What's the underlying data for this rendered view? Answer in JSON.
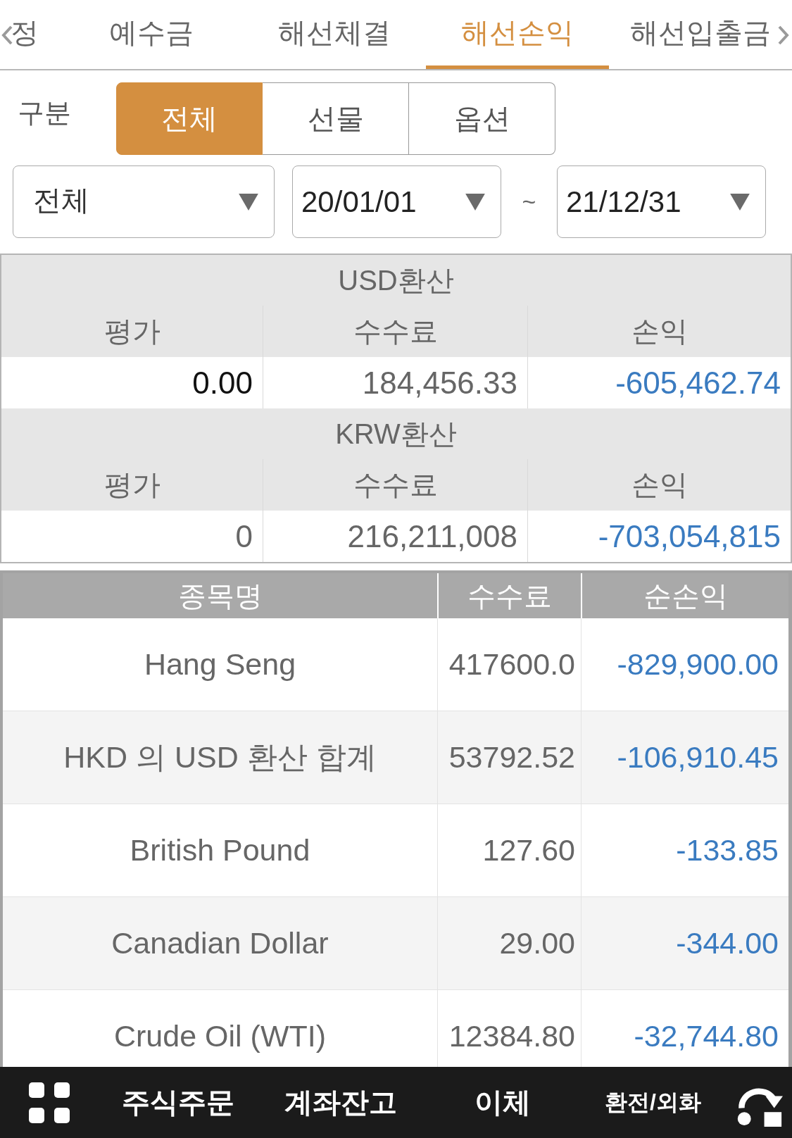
{
  "tabs": [
    {
      "label": "정",
      "selected": false
    },
    {
      "label": "예수금",
      "selected": false
    },
    {
      "label": "해선체결",
      "selected": false
    },
    {
      "label": "해선손익",
      "selected": true
    },
    {
      "label": "해선입출금",
      "selected": false
    }
  ],
  "filters": {
    "category_label": "구분",
    "segments": [
      {
        "label": "전체",
        "selected": true
      },
      {
        "label": "선물",
        "selected": false
      },
      {
        "label": "옵션",
        "selected": false
      }
    ],
    "type_dropdown": {
      "value": "전체"
    },
    "date_from": {
      "value": "20/01/01"
    },
    "date_separator": "~",
    "date_to": {
      "value": "21/12/31"
    }
  },
  "summary": [
    {
      "title": "USD환산",
      "columns": [
        "평가",
        "수수료",
        "손익"
      ],
      "values": [
        {
          "text": "0.00",
          "kind": "strong"
        },
        {
          "text": "184,456.33",
          "kind": "plain"
        },
        {
          "text": "-605,462.74",
          "kind": "loss"
        }
      ]
    },
    {
      "title": "KRW환산",
      "columns": [
        "평가",
        "수수료",
        "손익"
      ],
      "values": [
        {
          "text": "0",
          "kind": "plain"
        },
        {
          "text": "216,211,008",
          "kind": "plain"
        },
        {
          "text": "-703,054,815",
          "kind": "loss"
        }
      ]
    }
  ],
  "positions": {
    "columns": [
      "종목명",
      "수수료",
      "순손익"
    ],
    "rows": [
      {
        "name": "Hang Seng",
        "fee": "417600.0",
        "net": "-829,900.00"
      },
      {
        "name": "HKD 의 USD 환산 합계",
        "fee": "53792.52",
        "net": "-106,910.45"
      },
      {
        "name": "British Pound",
        "fee": "127.60",
        "net": "-133.85"
      },
      {
        "name": "Canadian Dollar",
        "fee": "29.00",
        "net": "-344.00"
      },
      {
        "name": "Crude Oil (WTI)",
        "fee": "12384.80",
        "net": "-32,744.80"
      }
    ]
  },
  "bottom_nav": [
    "주식주문",
    "계좌잔고",
    "이체",
    "환전/외화"
  ]
}
